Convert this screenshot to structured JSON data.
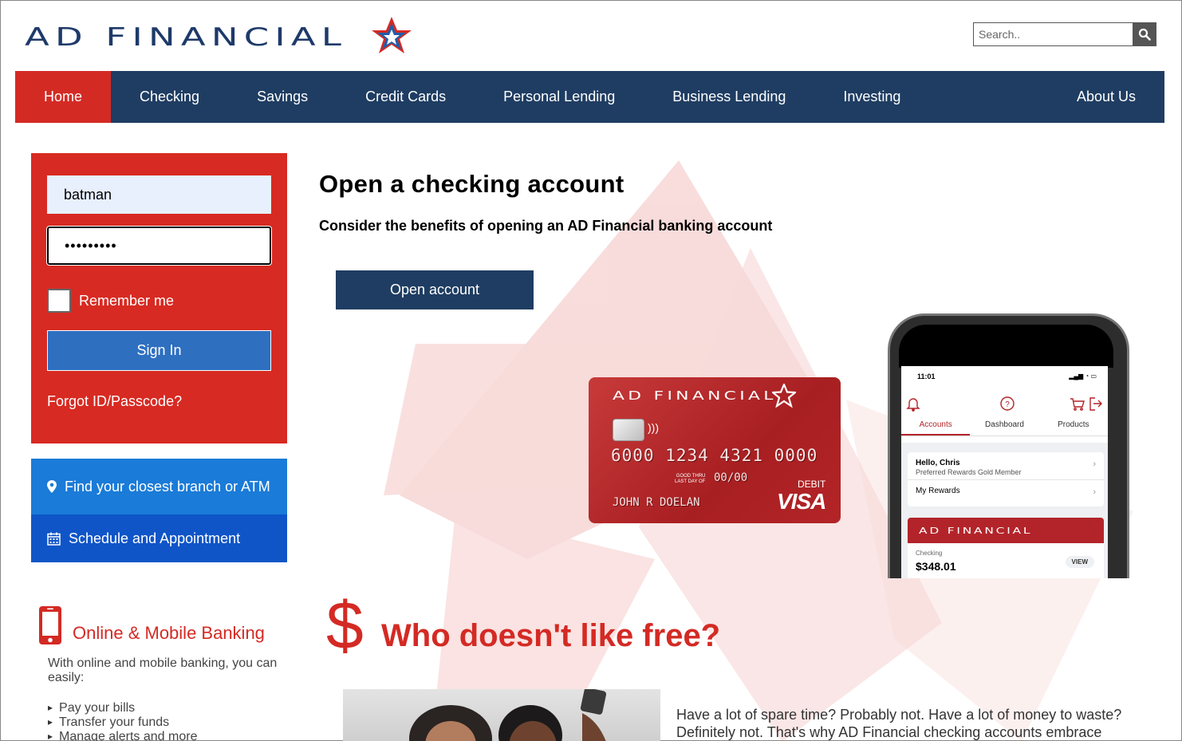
{
  "brand": {
    "name": "AD FINANCIAL",
    "primary_color": "#1f3d62",
    "accent_color": "#d42a24"
  },
  "search": {
    "placeholder": "Search..",
    "icon": "search-icon"
  },
  "nav": {
    "items": [
      {
        "label": "Home",
        "active": true
      },
      {
        "label": "Checking"
      },
      {
        "label": "Savings"
      },
      {
        "label": "Credit Cards"
      },
      {
        "label": "Personal Lending"
      },
      {
        "label": "Business Lending"
      },
      {
        "label": "Investing"
      },
      {
        "label": "About Us"
      }
    ]
  },
  "login": {
    "username_value": "batman",
    "password_value": "•••••••••",
    "remember_label": "Remember me",
    "remember_checked": false,
    "signin_label": "Sign In",
    "forgot_label": "Forgot ID/Passcode?"
  },
  "quick_links": {
    "branch_label": "Find your closest branch or ATM",
    "branch_icon": "map-pin-icon",
    "schedule_label": "Schedule and Appointment",
    "schedule_icon": "calendar-icon"
  },
  "online_banking": {
    "icon": "smartphone-icon",
    "title": "Online & Mobile Banking",
    "description": "With online and mobile banking, you can easily:",
    "items": [
      "Pay your bills",
      "Transfer your funds",
      "Manage alerts and more"
    ]
  },
  "hero": {
    "title": "Open a checking account",
    "subtitle": "Consider the benefits of opening an AD Financial banking account",
    "cta_label": "Open account"
  },
  "card": {
    "brand": "AD FINANCIAL",
    "number": "6000 1234 4321 0000",
    "good_thru_line1": "GOOD THRU",
    "good_thru_line2": "LAST DAY OF",
    "expiry": "00/00",
    "type": "DEBIT",
    "network": "VISA",
    "holder": "JOHN R DOELAN",
    "contactless_icon": "contactless-icon"
  },
  "phone": {
    "time": "11:01",
    "tabs": [
      "Accounts",
      "Dashboard",
      "Products"
    ],
    "greeting": "Hello, Chris",
    "membership": "Preferred Rewards Gold Member",
    "rewards": "My Rewards",
    "bank_name": "AD FINANCIAL",
    "account_type": "Checking",
    "balance": "$348.01",
    "view_label": "VIEW"
  },
  "free_section": {
    "symbol": "$",
    "title": "Who doesn't like free?",
    "text": "Have a lot of spare time? Probably not. Have a lot of money to waste? Definitely not. That's why AD Financial checking accounts embrace"
  }
}
